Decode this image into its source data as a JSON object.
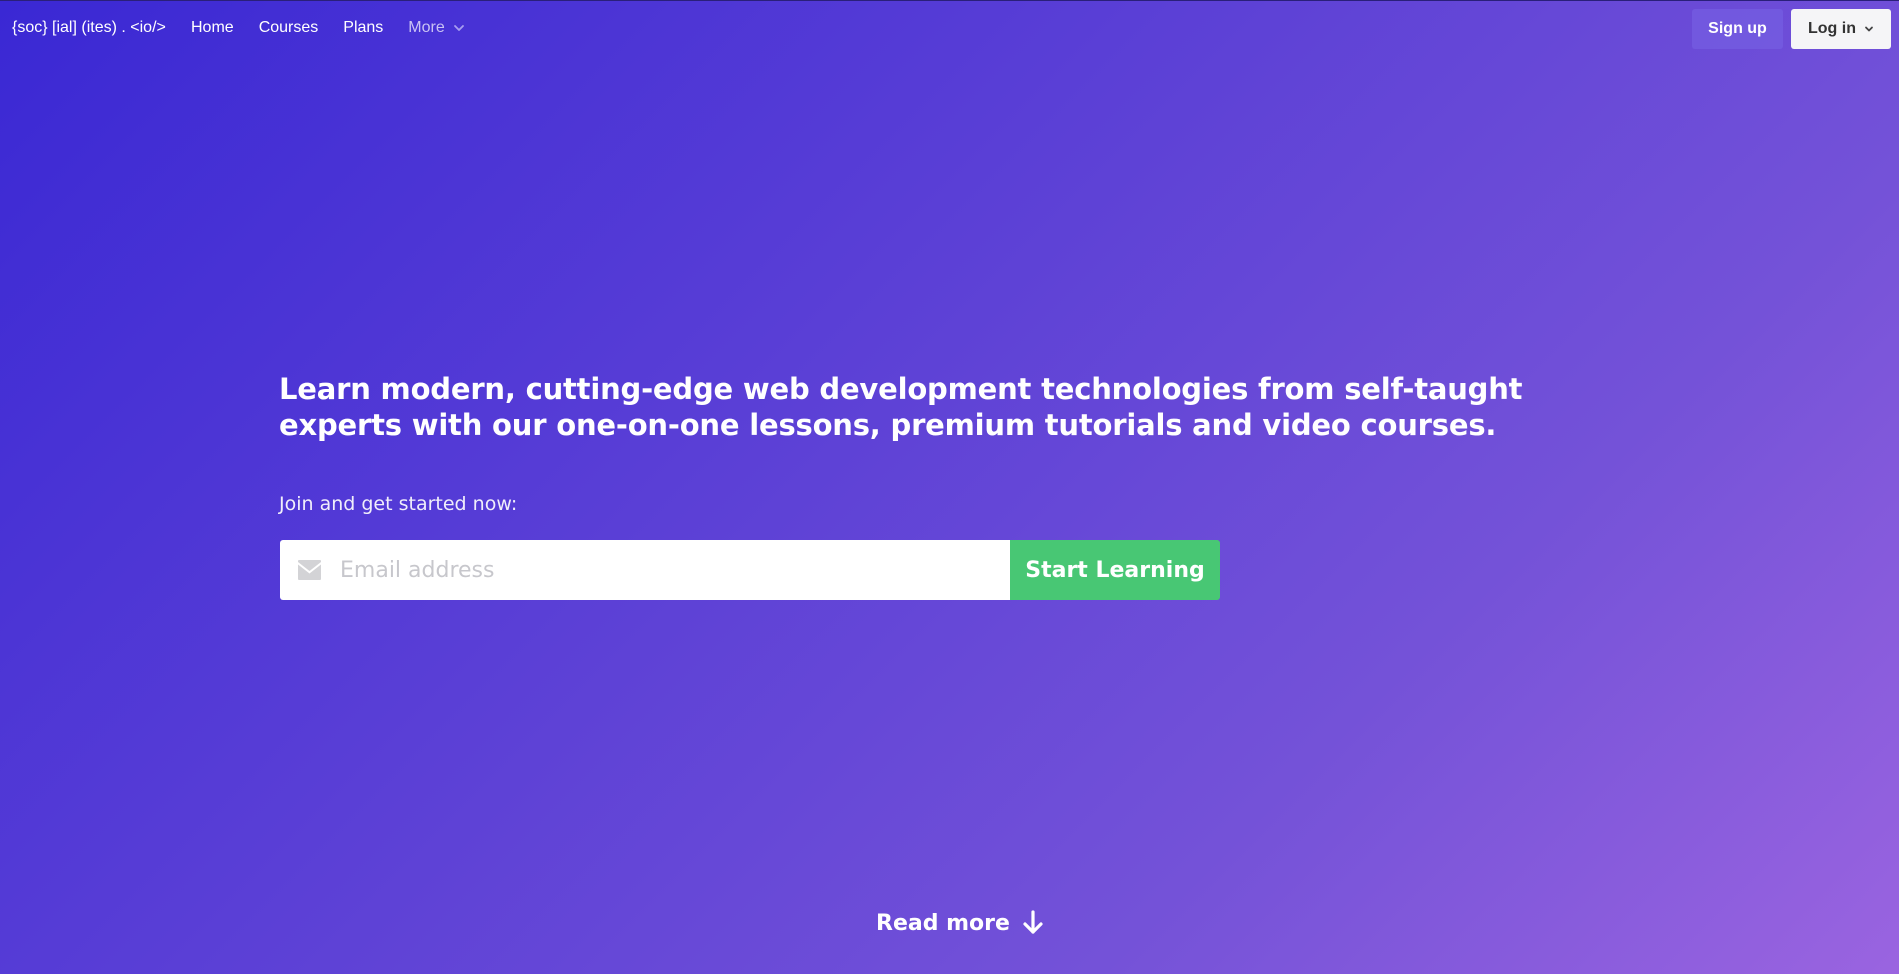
{
  "nav": {
    "brand": "{soc} [ial] (ites) . <io/>",
    "links": [
      "Home",
      "Courses",
      "Plans"
    ],
    "more_label": "More",
    "signup_label": "Sign up",
    "login_label": "Log in"
  },
  "hero": {
    "title": "Learn modern, cutting-edge web development technologies from self-taught experts with our one-on-one lessons, premium tutorials and video courses.",
    "subtitle": "Join and get started now:",
    "email_placeholder": "Email address",
    "cta_label": "Start Learning"
  },
  "footer": {
    "read_more_label": "Read more"
  },
  "colors": {
    "gradient_start": "#3a28d4",
    "gradient_end": "#9a64e0",
    "cta_green": "#48c774"
  },
  "icons": {
    "email": "envelope-icon",
    "more": "chevron-down-icon",
    "login": "chevron-down-icon",
    "read_more": "arrow-down-icon"
  }
}
